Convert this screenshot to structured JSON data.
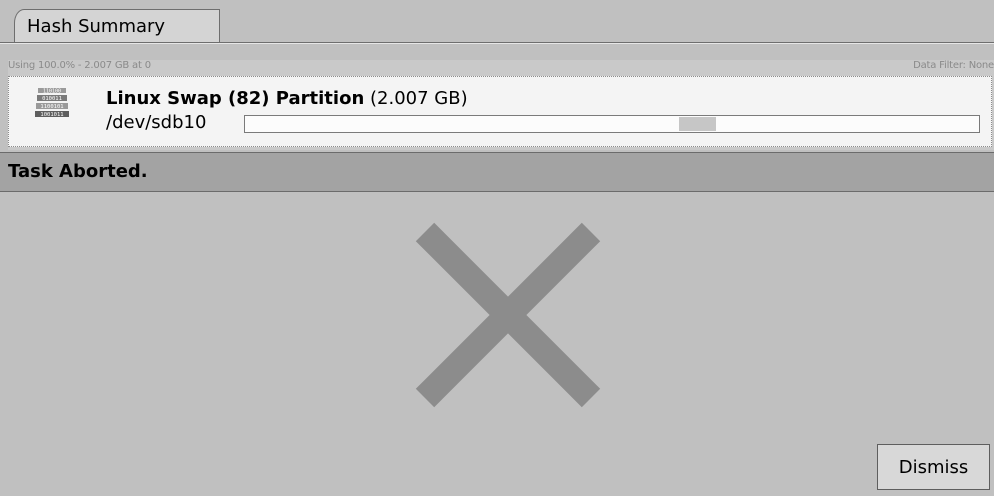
{
  "tabs": [
    {
      "label": "Hash Summary",
      "active": true
    }
  ],
  "summary": {
    "usage_text": "Using 100.0% - 2.007 GB at 0",
    "data_filter_text": "Data Filter: None",
    "device": {
      "icon": "disk-binary-icon",
      "name": "Linux Swap (82) Partition",
      "size": "(2.007 GB)",
      "path": "/dev/sdb10",
      "usage_range": [
        0.591,
        0.642
      ]
    }
  },
  "status": {
    "message": "Task Aborted."
  },
  "abort_icon": "cross-icon",
  "actions": {
    "dismiss_label": "Dismiss"
  },
  "colors": {
    "background": "#c0c0c0",
    "status_bar": "#a3a3a3",
    "cross": "#8c8c8c",
    "progress_segment": "#c6c6c6"
  }
}
